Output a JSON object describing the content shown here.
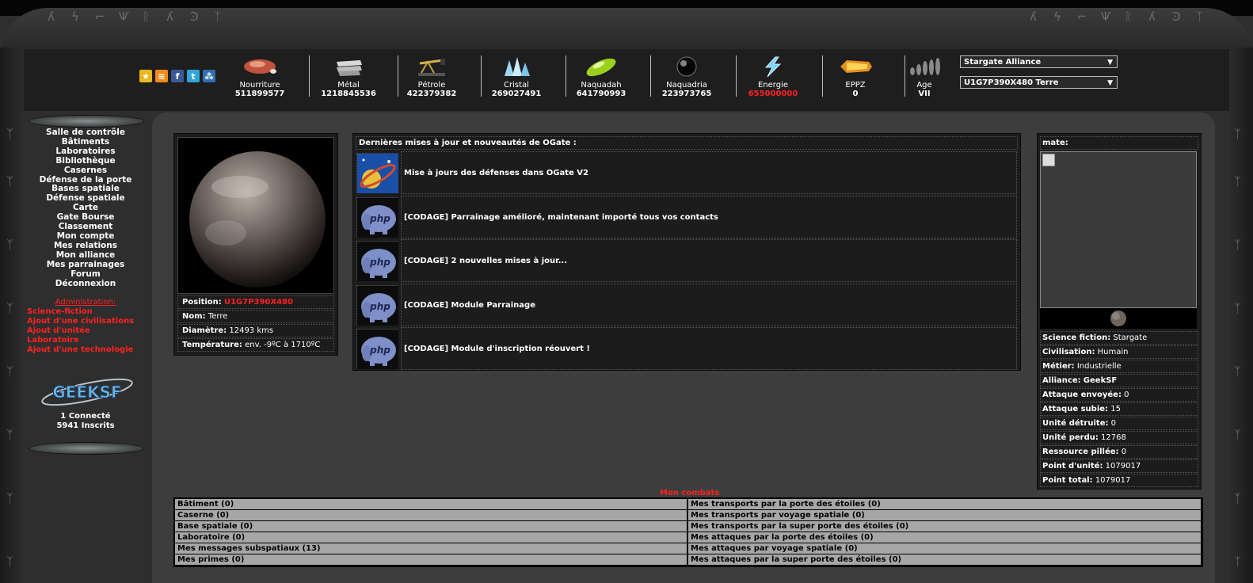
{
  "header": {
    "social": [
      {
        "icon": "favorite-icon",
        "color": "#e8b820",
        "glyph": "★"
      },
      {
        "icon": "rss-icon",
        "color": "#f08a1c",
        "glyph": "≋"
      },
      {
        "icon": "facebook-icon",
        "color": "#3b5998",
        "glyph": "f"
      },
      {
        "icon": "twitter-icon",
        "color": "#2fa6d6",
        "glyph": "t"
      },
      {
        "icon": "myspace-icon",
        "color": "#2f6fb0",
        "glyph": "⁂"
      }
    ],
    "resources": [
      {
        "name": "Nourriture",
        "value": "511899577",
        "icon": "meat-icon"
      },
      {
        "name": "Métal",
        "value": "1218845536",
        "icon": "metal-icon"
      },
      {
        "name": "Pétrole",
        "value": "422379382",
        "icon": "oil-pump-icon"
      },
      {
        "name": "Cristal",
        "value": "269027491",
        "icon": "crystal-icon"
      },
      {
        "name": "Naquadah",
        "value": "641790993",
        "icon": "naquadah-icon"
      },
      {
        "name": "Naquadria",
        "value": "223973765",
        "icon": "naquadria-icon"
      },
      {
        "name": "Energie",
        "value": "655000000",
        "icon": "lightning-icon",
        "status_color": "#ff2020"
      },
      {
        "name": "EPPZ",
        "value": "0",
        "icon": "zpm-icon"
      },
      {
        "name": "Age",
        "value": "VII",
        "icon": "evolution-icon"
      }
    ],
    "selects": {
      "alliance": "Stargate Alliance",
      "planet": "U1G7P390X480 Terre"
    }
  },
  "nav": [
    "Salle de contrôle",
    "Bâtiments",
    "Laboratoires",
    "Bibliothèque",
    "Casernes",
    "Défense de la porte",
    "Bases spatiale",
    "Défense spatiale",
    "Carte",
    "Gate Bourse",
    "Classement",
    "Mon compte",
    "Mes relations",
    "Mon alliance",
    "Mes parrainages",
    "Forum",
    "Déconnexion"
  ],
  "admin": {
    "title": "Administration:",
    "links": [
      "Science-fiction",
      "Ajout d'une civilisations",
      "Ajout d'unitée",
      "Laboratoire",
      "Ajout d'une technologie"
    ]
  },
  "logo_text": "GEEKSF",
  "stats": {
    "connected": "1 Connecté",
    "registered": "5941 Inscrits"
  },
  "planet": {
    "position_label": "Position:",
    "position_value": "U1G7P390X480",
    "name_label": "Nom:",
    "name_value": "Terre",
    "diameter_label": "Diamètre:",
    "diameter_value": "12493 kms",
    "temp_label": "Température:",
    "temp_value": "env. -9ºC à 1710ºC"
  },
  "news": {
    "title": "Dernières mises à jour et nouveautés de OGate :",
    "items": [
      {
        "text": "Mise à jours des défenses dans OGate V2",
        "icon": "space-icon"
      },
      {
        "text": "[CODAGE] Parrainage amélioré, maintenant importé tous vos contacts",
        "icon": "php-icon"
      },
      {
        "text": "[CODAGE] 2 nouvelles mises à jour...",
        "icon": "php-icon"
      },
      {
        "text": "[CODAGE] Module Parrainage",
        "icon": "php-icon"
      },
      {
        "text": "[CODAGE] Module d'inscription réouvert !",
        "icon": "php-icon"
      }
    ]
  },
  "user": {
    "title": "mate:",
    "rows": [
      {
        "label": "Science fiction:",
        "value": "Stargate"
      },
      {
        "label": "Civilisation:",
        "value": "Humain"
      },
      {
        "label": "Métier:",
        "value": "Industrielle"
      },
      {
        "label": "Alliance:",
        "value": "GeekSF",
        "value_bold": true
      },
      {
        "label": "Attaque envoyée:",
        "value": "0"
      },
      {
        "label": "Attaque subie:",
        "value": "15"
      },
      {
        "label": "Unité détruite:",
        "value": "0"
      },
      {
        "label": "Unité perdu:",
        "value": "12768"
      },
      {
        "label": "Ressource pillée:",
        "value": "0"
      },
      {
        "label": "Point d'unité:",
        "value": "1079017"
      },
      {
        "label": "Point total:",
        "value": "1079017"
      }
    ]
  },
  "fights": {
    "title": "Mon combats",
    "left": [
      "Bâtiment (0)",
      "Caserne (0)",
      "Base spatiale (0)",
      "Laboratoire (0)",
      "Mes messages subspatiaux (13)",
      "Mes primes (0)"
    ],
    "right": [
      "Mes transports par la porte des étoiles (0)",
      "Mes transports par voyage spatiale (0)",
      "Mes transports par la super porte des étoiles (0)",
      "Mes attaques par la porte des étoiles (0)",
      "Mes attaques par voyage spatiale (0)",
      "Mes attaques par la super porte des étoiles (0)"
    ]
  },
  "colors": {
    "accent_red": "#ff2020",
    "row_gray": "#a7a7a7"
  }
}
